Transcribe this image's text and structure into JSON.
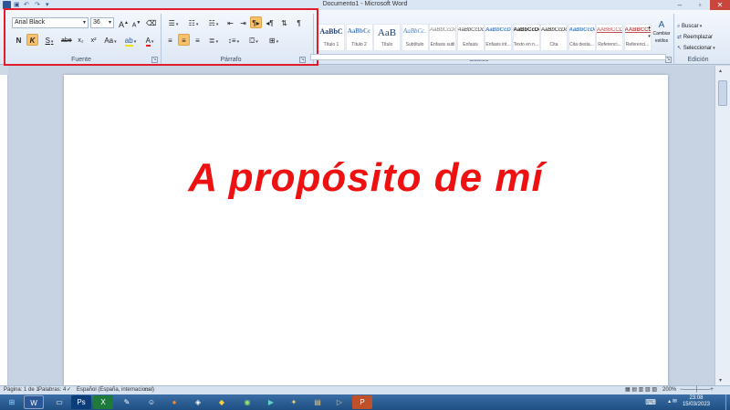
{
  "window": {
    "title": "Documento1 - Microsoft Word"
  },
  "ribbon": {
    "font": {
      "family": "Arial Black",
      "size": "36",
      "group_label": "Fuente",
      "bold_label": "N",
      "italic_label": "K",
      "underline_label": "S",
      "strike_label": "abe",
      "subscript_label": "x₂",
      "superscript_label": "x²",
      "case_label": "Aa",
      "grow_label": "A",
      "shrink_label": "A",
      "font_color_label": "A"
    },
    "paragraph": {
      "group_label": "Párrafo",
      "pilcrow_label": "¶"
    },
    "styles": {
      "group_label": "Estilos",
      "items": [
        {
          "sample": "AaBbC",
          "name": "Título 1"
        },
        {
          "sample": "AaBbCc",
          "name": "Título 2"
        },
        {
          "sample": "AaB",
          "name": "Título"
        },
        {
          "sample": "AaBbCc.",
          "name": "Subtítulo"
        },
        {
          "sample": "AaBbCcDc",
          "name": "Énfasis sutil"
        },
        {
          "sample": "AaBbCcDc",
          "name": "Énfasis"
        },
        {
          "sample": "AaBbCcDc",
          "name": "Énfasis int..."
        },
        {
          "sample": "AaBbCcDc",
          "name": "Texto en n..."
        },
        {
          "sample": "AaBbCcDc",
          "name": "Cita"
        },
        {
          "sample": "AaBbCcDc",
          "name": "Cita desta..."
        },
        {
          "sample": "AABBCCDI",
          "name": "Referenci..."
        },
        {
          "sample": "AABBCCDI",
          "name": "Referenci..."
        }
      ],
      "change_label": "Cambiar estilos"
    },
    "editing": {
      "group_label": "Edición",
      "find_label": "Buscar",
      "replace_label": "Reemplazar",
      "select_label": "Seleccionar"
    }
  },
  "document": {
    "text": "A propósito de mí",
    "text_color": "#ee1111"
  },
  "statusbar": {
    "page": "Página: 1 de 1",
    "words": "Palabras: 4",
    "language": "Español (España, internacional)",
    "zoom": "200%"
  },
  "taskbar": {
    "time": "23:08",
    "date": "15/03/2023"
  },
  "colors": {
    "highlight_border": "#e11d2b",
    "active_button": "#f7c26a"
  }
}
